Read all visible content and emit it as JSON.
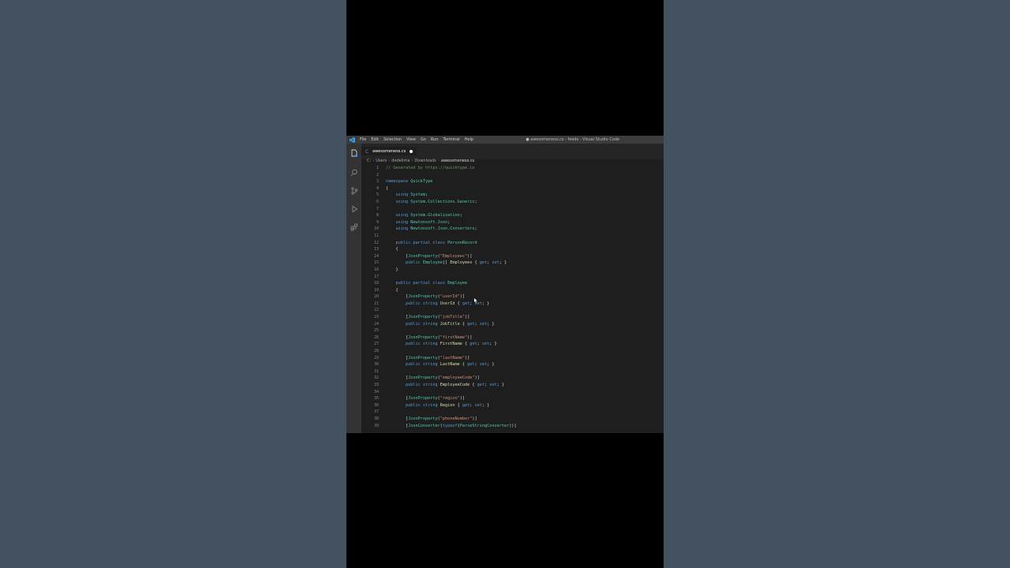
{
  "window": {
    "title": "● awesomeness.cs - feeds - Visual Studio Code",
    "menu": [
      "File",
      "Edit",
      "Selection",
      "View",
      "Go",
      "Run",
      "Terminal",
      "Help"
    ]
  },
  "tab": {
    "label": "awesomeness.cs"
  },
  "breadcrumb": [
    "C:",
    "Users",
    "dedelima",
    "Downloads",
    "awesomeness.cs"
  ],
  "colors": {
    "background": "#435160",
    "editor_bg": "#1e1e1e",
    "keyword": "#569cd6",
    "type": "#4ec9b0",
    "string": "#ce9178",
    "comment": "#6a9955"
  },
  "activity_icons": [
    "explorer-icon",
    "search-icon",
    "source-control-icon",
    "run-debug-icon",
    "extensions-icon"
  ],
  "code": {
    "line_numbers": [
      "1",
      "2",
      "3",
      "4",
      "5",
      "6",
      "7",
      "8",
      "9",
      "10",
      "11",
      "12",
      "13",
      "14",
      "15",
      "16",
      "17",
      "18",
      "19",
      "20",
      "21",
      "22",
      "23",
      "24",
      "25",
      "26",
      "27",
      "28",
      "29",
      "30",
      "31",
      "32",
      "33",
      "34",
      "35",
      "36",
      "37",
      "38",
      "39"
    ],
    "lines": [
      [
        [
          "cm",
          "// Generated by https://quicktype.io"
        ]
      ],
      [],
      [
        [
          "kw",
          "namespace "
        ],
        [
          "ty",
          "QuickType"
        ]
      ],
      [
        [
          "",
          "{"
        ]
      ],
      [
        [
          "",
          "    "
        ],
        [
          "kw",
          "using "
        ],
        [
          "ty",
          "System"
        ],
        [
          "",
          ";"
        ]
      ],
      [
        [
          "",
          "    "
        ],
        [
          "kw",
          "using "
        ],
        [
          "ty",
          "System.Collections.Generic"
        ],
        [
          "",
          ";"
        ]
      ],
      [],
      [
        [
          "",
          "    "
        ],
        [
          "kw",
          "using "
        ],
        [
          "ty",
          "System.Globalization"
        ],
        [
          "",
          ";"
        ]
      ],
      [
        [
          "",
          "    "
        ],
        [
          "kw",
          "using "
        ],
        [
          "ty",
          "Newtonsoft.Json"
        ],
        [
          "",
          ";"
        ]
      ],
      [
        [
          "",
          "    "
        ],
        [
          "kw",
          "using "
        ],
        [
          "ty",
          "Newtonsoft.Json.Converters"
        ],
        [
          "",
          ";"
        ]
      ],
      [],
      [
        [
          "",
          "    "
        ],
        [
          "kw",
          "public partial class "
        ],
        [
          "ty",
          "PersonRecord"
        ]
      ],
      [
        [
          "",
          "    {"
        ]
      ],
      [
        [
          "",
          "        ["
        ],
        [
          "ty",
          "JsonProperty"
        ],
        [
          "",
          "("
        ],
        [
          "st",
          "\"Employees\""
        ],
        [
          "",
          ")]"
        ]
      ],
      [
        [
          "",
          "        "
        ],
        [
          "kw",
          "public "
        ],
        [
          "ty",
          "Employee"
        ],
        [
          "",
          "[] "
        ],
        [
          "pn",
          "Employees"
        ],
        [
          "",
          " { "
        ],
        [
          "kw",
          "get"
        ],
        [
          "",
          "; "
        ],
        [
          "kw",
          "set"
        ],
        [
          "",
          "; }"
        ]
      ],
      [
        [
          "",
          "    }"
        ]
      ],
      [],
      [
        [
          "",
          "    "
        ],
        [
          "kw",
          "public partial class "
        ],
        [
          "ty",
          "Employee"
        ]
      ],
      [
        [
          "",
          "    {"
        ]
      ],
      [
        [
          "",
          "        ["
        ],
        [
          "ty",
          "JsonProperty"
        ],
        [
          "",
          "("
        ],
        [
          "st",
          "\"userId\""
        ],
        [
          "",
          ")]"
        ]
      ],
      [
        [
          "",
          "        "
        ],
        [
          "kw",
          "public string "
        ],
        [
          "pn",
          "UserId"
        ],
        [
          "",
          " { "
        ],
        [
          "kw",
          "get"
        ],
        [
          "",
          "; "
        ],
        [
          "kw",
          "set"
        ],
        [
          "",
          "; }"
        ]
      ],
      [],
      [
        [
          "",
          "        ["
        ],
        [
          "ty",
          "JsonProperty"
        ],
        [
          "",
          "("
        ],
        [
          "st",
          "\"jobTitle\""
        ],
        [
          "",
          ")]"
        ]
      ],
      [
        [
          "",
          "        "
        ],
        [
          "kw",
          "public string "
        ],
        [
          "pn",
          "JobTitle"
        ],
        [
          "",
          " { "
        ],
        [
          "kw",
          "get"
        ],
        [
          "",
          "; "
        ],
        [
          "kw",
          "set"
        ],
        [
          "",
          "; }"
        ]
      ],
      [],
      [
        [
          "",
          "        ["
        ],
        [
          "ty",
          "JsonProperty"
        ],
        [
          "",
          "("
        ],
        [
          "st",
          "\"firstName\""
        ],
        [
          "",
          ")]"
        ]
      ],
      [
        [
          "",
          "        "
        ],
        [
          "kw",
          "public string "
        ],
        [
          "pn",
          "FirstName"
        ],
        [
          "",
          " { "
        ],
        [
          "kw",
          "get"
        ],
        [
          "",
          "; "
        ],
        [
          "kw",
          "set"
        ],
        [
          "",
          "; }"
        ]
      ],
      [],
      [
        [
          "",
          "        ["
        ],
        [
          "ty",
          "JsonProperty"
        ],
        [
          "",
          "("
        ],
        [
          "st",
          "\"lastName\""
        ],
        [
          "",
          ")]"
        ]
      ],
      [
        [
          "",
          "        "
        ],
        [
          "kw",
          "public string "
        ],
        [
          "pn",
          "LastName"
        ],
        [
          "",
          " { "
        ],
        [
          "kw",
          "get"
        ],
        [
          "",
          "; "
        ],
        [
          "kw",
          "set"
        ],
        [
          "",
          "; }"
        ]
      ],
      [],
      [
        [
          "",
          "        ["
        ],
        [
          "ty",
          "JsonProperty"
        ],
        [
          "",
          "("
        ],
        [
          "st",
          "\"employeeCode\""
        ],
        [
          "",
          ")]"
        ]
      ],
      [
        [
          "",
          "        "
        ],
        [
          "kw",
          "public string "
        ],
        [
          "pn",
          "EmployeeCode"
        ],
        [
          "",
          " { "
        ],
        [
          "kw",
          "get"
        ],
        [
          "",
          "; "
        ],
        [
          "kw",
          "set"
        ],
        [
          "",
          "; }"
        ]
      ],
      [],
      [
        [
          "",
          "        ["
        ],
        [
          "ty",
          "JsonProperty"
        ],
        [
          "",
          "("
        ],
        [
          "st",
          "\"region\""
        ],
        [
          "",
          ")]"
        ]
      ],
      [
        [
          "",
          "        "
        ],
        [
          "kw",
          "public string "
        ],
        [
          "pn",
          "Region"
        ],
        [
          "",
          " { "
        ],
        [
          "kw",
          "get"
        ],
        [
          "",
          "; "
        ],
        [
          "kw",
          "set"
        ],
        [
          "",
          "; }"
        ]
      ],
      [],
      [
        [
          "",
          "        ["
        ],
        [
          "ty",
          "JsonProperty"
        ],
        [
          "",
          "("
        ],
        [
          "st",
          "\"phoneNumber\""
        ],
        [
          "",
          ")]"
        ]
      ],
      [
        [
          "",
          "        ["
        ],
        [
          "ty",
          "JsonConverter"
        ],
        [
          "",
          "("
        ],
        [
          "kw",
          "typeof"
        ],
        [
          "",
          "("
        ],
        [
          "ty",
          "ParseStringConverter"
        ],
        [
          "",
          "))]"
        ]
      ]
    ]
  }
}
